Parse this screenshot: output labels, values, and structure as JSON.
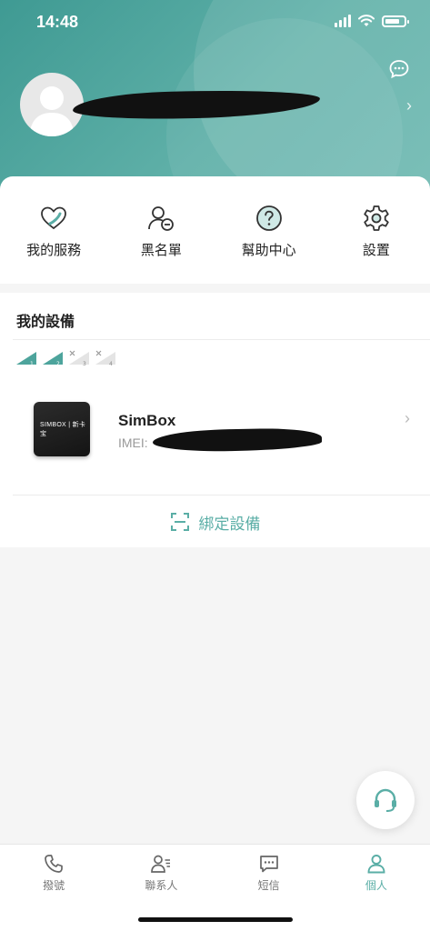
{
  "status_bar": {
    "time": "14:48"
  },
  "quick_actions": [
    {
      "label": "我的服務",
      "icon": "heart-icon"
    },
    {
      "label": "黑名單",
      "icon": "user-block-icon"
    },
    {
      "label": "幫助中心",
      "icon": "help-icon"
    },
    {
      "label": "設置",
      "icon": "gear-icon"
    }
  ],
  "devices_section": {
    "title": "我的設備",
    "sim_slots": [
      "1",
      "2",
      "3",
      "4"
    ],
    "device": {
      "name": "SimBox",
      "imei_label": "IMEI: ",
      "image_label": "SIMBOX | 新卡宝"
    },
    "bind_label": "綁定設備"
  },
  "tabbar": {
    "tabs": [
      {
        "label": "撥號",
        "icon": "phone-icon",
        "active": false
      },
      {
        "label": "聯系人",
        "icon": "contacts-icon",
        "active": false
      },
      {
        "label": "短信",
        "icon": "message-icon",
        "active": false
      },
      {
        "label": "個人",
        "icon": "person-icon",
        "active": true
      }
    ]
  },
  "colors": {
    "accent": "#5aaea6",
    "header": "#4da49c"
  }
}
